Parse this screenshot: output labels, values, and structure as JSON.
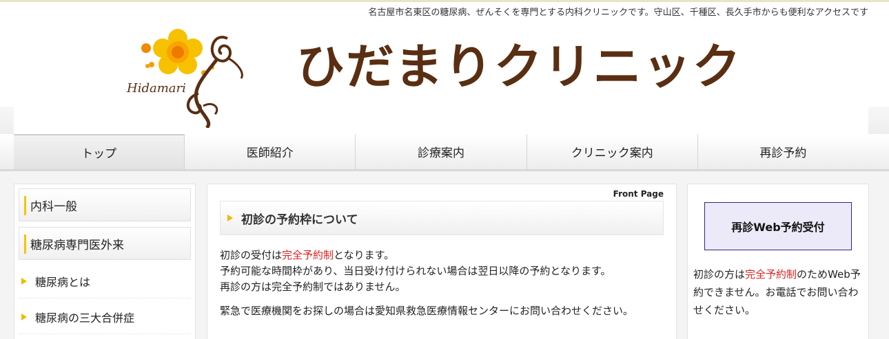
{
  "header": {
    "tagline": "名古屋市名東区の糖尿病、ぜんそくを専門とする内科クリニックです。守山区、千種区、長久手市からも便利なアクセスです",
    "logo_text": "Hidamari",
    "site_title": "ひだまりクリニック"
  },
  "nav": {
    "items": [
      {
        "label": "トップ"
      },
      {
        "label": "医師紹介"
      },
      {
        "label": "診療案内"
      },
      {
        "label": "クリニック案内"
      },
      {
        "label": "再診予約"
      }
    ]
  },
  "sidebar_left": {
    "categories": [
      {
        "label": "内科一般"
      },
      {
        "label": "糖尿病専門医外来"
      }
    ],
    "links": [
      {
        "label": "糖尿病とは"
      },
      {
        "label": "糖尿病の三大合併症"
      }
    ]
  },
  "main": {
    "front_page": "Front Page",
    "notice_title": "初診の予約枠について",
    "line1_before": "初診の受付は",
    "line1_red": "完全予約制",
    "line1_after": "となります。",
    "line2": "予約可能な時間枠があり、当日受け付けられない場合は翌日以降の予約となります。",
    "line3": "再診の方は完全予約制ではありません。",
    "line4": "緊急で医療機関をお探しの場合は愛知県救急医療情報センターにお問い合わせください。"
  },
  "sidebar_right": {
    "web_button": "再診Web予約受付",
    "text_before": "初診の方は",
    "text_red": "完全予約制",
    "text_after": "のためWeb予約できません。お電話でお問い合わせください。"
  },
  "colors": {
    "title_brown": "#5a2e12",
    "accent_yellow": "#f5c500",
    "alert_red": "#e02020",
    "button_border": "#2a2a7a",
    "button_bg": "#ece9f8"
  }
}
